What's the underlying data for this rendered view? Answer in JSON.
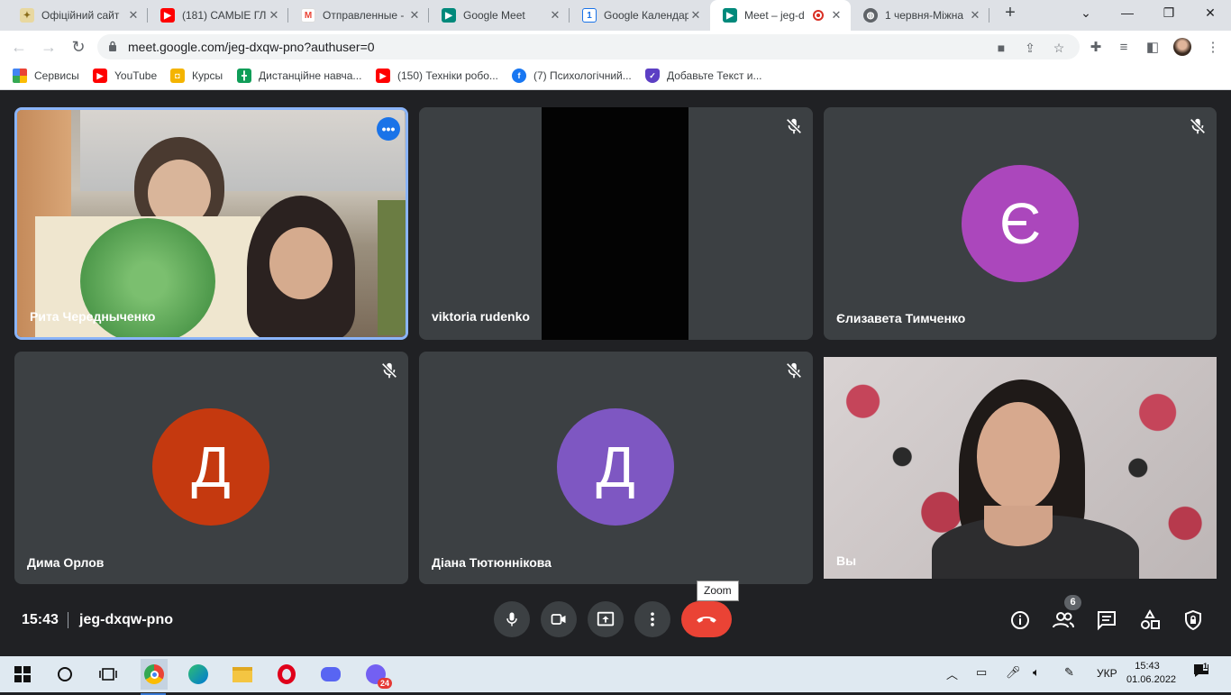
{
  "tabs": [
    {
      "title": "Офіційний сайт",
      "favicon": "school-icon",
      "color": "#c9a33a"
    },
    {
      "title": "(181) САМЫЕ ГЛ",
      "favicon": "youtube-icon",
      "color": "#ff0000"
    },
    {
      "title": "Отправленные -",
      "favicon": "gmail-icon",
      "color": "#ea4335"
    },
    {
      "title": "Google Meet",
      "favicon": "meet-icon",
      "color": "#00897b"
    },
    {
      "title": "Google Календар",
      "favicon": "calendar-icon",
      "color": "#1a73e8",
      "badge": "1"
    },
    {
      "title": "Meet – jeg-d",
      "favicon": "meet-icon",
      "color": "#00897b",
      "active": true
    },
    {
      "title": "1 червня-Міжна",
      "favicon": "globe-icon",
      "color": "#5f6368"
    }
  ],
  "address": {
    "url": "meet.google.com/jeg-dxqw-pno?authuser=0"
  },
  "bookmarks": [
    {
      "label": "Сервисы",
      "icon": "apps-grid-icon"
    },
    {
      "label": "YouTube",
      "icon": "youtube-icon"
    },
    {
      "label": "Курсы",
      "icon": "classroom-icon"
    },
    {
      "label": "Дистанційне навча...",
      "icon": "green-plus-icon"
    },
    {
      "label": "(150) Техніки робо...",
      "icon": "youtube-icon"
    },
    {
      "label": "(7) Психологічний...",
      "icon": "facebook-icon"
    },
    {
      "label": "Добавьте Текст и...",
      "icon": "shield-icon"
    }
  ],
  "participants": [
    {
      "name": "Рита Чередныченко",
      "type": "video",
      "more_menu": true
    },
    {
      "name": "viktoria rudenko",
      "type": "video-dark",
      "muted": true
    },
    {
      "name": "Єлизавета Тимченко",
      "type": "avatar",
      "initial": "Є",
      "color": "#ab47bc",
      "muted": true
    },
    {
      "name": "Дима Орлов",
      "type": "avatar",
      "initial": "Д",
      "color": "#c5390f",
      "muted": true
    },
    {
      "name": "Діана Тютюннікова",
      "type": "avatar",
      "initial": "Д",
      "color": "#7e57c2",
      "muted": true
    },
    {
      "name": "Вы",
      "type": "self-video"
    }
  ],
  "meeting": {
    "time": "15:43",
    "code": "jeg-dxqw-pno",
    "tooltip": "Zoom",
    "participant_count": "6"
  },
  "taskbar": {
    "language": "УКР",
    "time": "15:43",
    "date": "01.06.2022",
    "viber_badge": "24",
    "notifications": "1"
  },
  "colors": {
    "meet_bg": "#202124",
    "tile_bg": "#3c4043",
    "hangup": "#ea4335",
    "active_border": "#8ab4f8"
  }
}
